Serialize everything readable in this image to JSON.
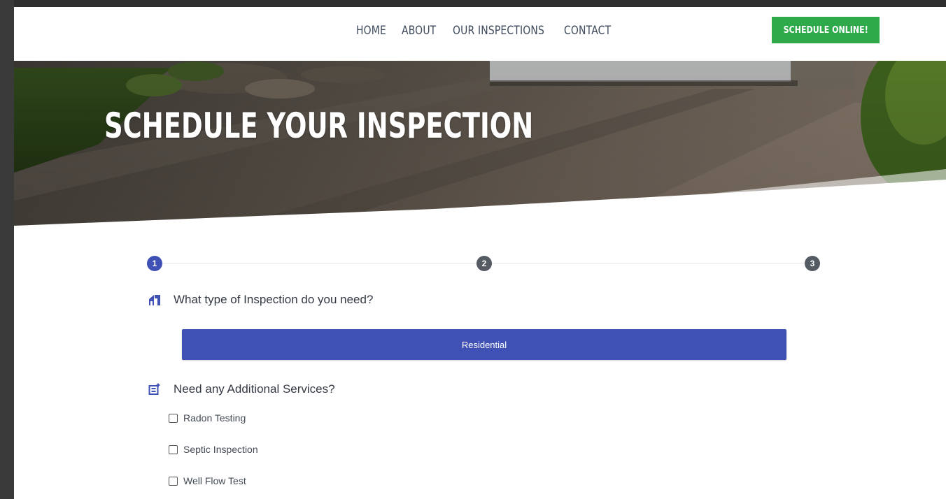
{
  "nav": {
    "items": [
      {
        "label": "HOME"
      },
      {
        "label": "ABOUT"
      },
      {
        "label": "OUR INSPECTIONS"
      },
      {
        "label": "CONTACT"
      }
    ],
    "cta_label": "SCHEDULE ONLINE!"
  },
  "hero": {
    "title": "SCHEDULE YOUR INSPECTION"
  },
  "stepper": {
    "steps": [
      "1",
      "2",
      "3"
    ],
    "current": 1
  },
  "form": {
    "inspection_question": "What type of Inspection do you need?",
    "inspection_selected": "Residential",
    "services_question": "Need any Additional Services?",
    "services": [
      {
        "label": "Radon Testing",
        "checked": false
      },
      {
        "label": "Septic Inspection",
        "checked": false
      },
      {
        "label": "Well Flow Test",
        "checked": false
      }
    ]
  },
  "colors": {
    "primary": "#3f51b5",
    "cta": "#2eaa4a",
    "step_inactive": "#555b63",
    "nav_text": "#3d4a5c"
  }
}
